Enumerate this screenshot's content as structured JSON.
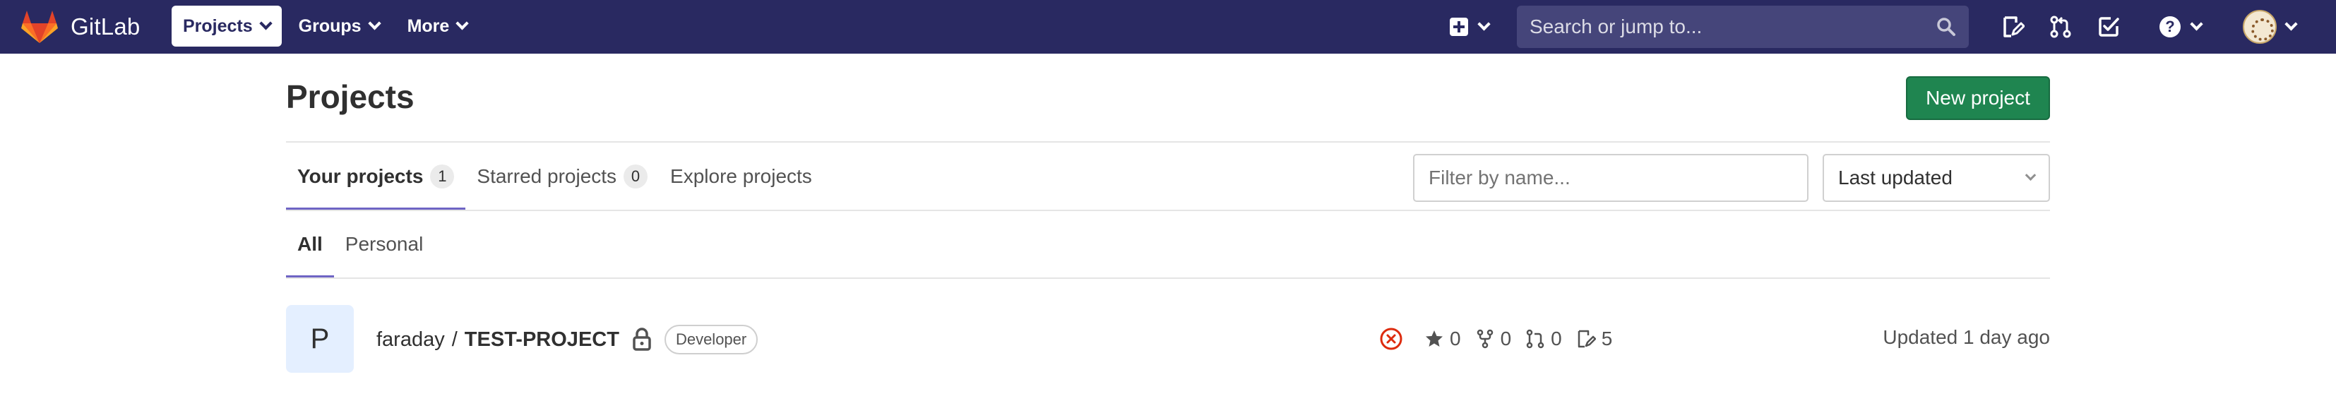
{
  "navbar": {
    "brand": "GitLab",
    "menu": [
      {
        "label": "Projects",
        "active": true
      },
      {
        "label": "Groups",
        "active": false
      },
      {
        "label": "More",
        "active": false
      }
    ],
    "search_placeholder": "Search or jump to...",
    "icons": [
      "plus-square-icon",
      "issues-icon",
      "merge-request-icon",
      "todos-icon",
      "help-icon",
      "user-avatar"
    ]
  },
  "page": {
    "title": "Projects",
    "new_project_label": "New project",
    "tabs": [
      {
        "label": "Your projects",
        "count": "1",
        "active": true
      },
      {
        "label": "Starred projects",
        "count": "0",
        "active": false
      },
      {
        "label": "Explore projects",
        "active": false
      }
    ],
    "filter_placeholder": "Filter by name...",
    "sort_selected": "Last updated",
    "subtabs": [
      {
        "label": "All",
        "active": true
      },
      {
        "label": "Personal",
        "active": false
      }
    ]
  },
  "projects": [
    {
      "avatar_letter": "P",
      "owner": "faraday",
      "separator": "/",
      "name": "TEST-PROJECT",
      "visibility_icon": "lock-icon",
      "role": "Developer",
      "pipeline_status": "failed",
      "stars": "0",
      "forks": "0",
      "merge_requests": "0",
      "issues": "5",
      "updated": "Updated 1 day ago"
    }
  ],
  "colors": {
    "navbar_bg": "#292961",
    "search_bg": "#45457a",
    "primary_button": "#1f8550",
    "active_tab_underline": "#6e64c4",
    "failed_status": "#dd2b0e",
    "project_avatar_bg": "#e4efff"
  }
}
